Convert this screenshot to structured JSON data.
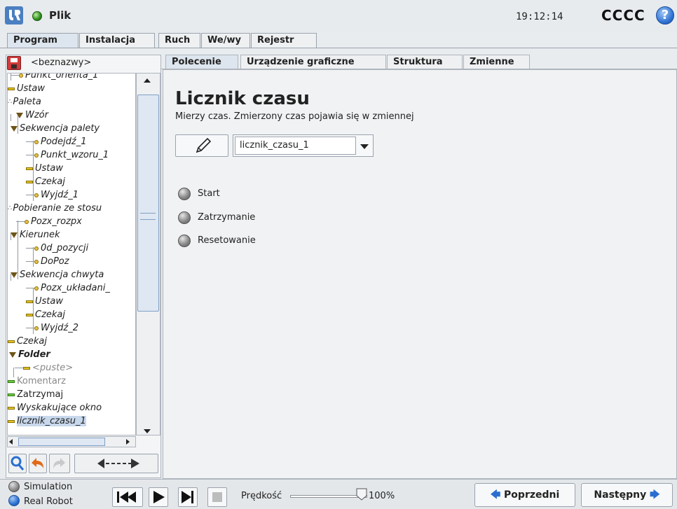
{
  "titlebar": {
    "file_menu": "Plik",
    "clock": "19:12:14",
    "robot_name": "CCCC",
    "help_label": "?"
  },
  "main_tabs": [
    "Program",
    "Instalacja",
    "Ruch",
    "We/wy",
    "Rejestr"
  ],
  "program": {
    "name": "<beznazwy>"
  },
  "tree": [
    {
      "label": "Punkt_orienta_1",
      "icon": "waypoint-icon"
    },
    {
      "label": "Ustaw",
      "icon": "set-icon"
    },
    {
      "label": "Paleta",
      "icon": "pallet-icon"
    },
    {
      "label": "Wzór",
      "icon": "folder-triangle-icon"
    },
    {
      "label": "Sekwencja palety",
      "icon": "folder-triangle-icon"
    },
    {
      "label": "Podejdź_1",
      "icon": "waypoint-icon"
    },
    {
      "label": "Punkt_wzoru_1",
      "icon": "waypoint-icon"
    },
    {
      "label": "Ustaw",
      "icon": "set-icon"
    },
    {
      "label": "Czekaj",
      "icon": "wait-icon"
    },
    {
      "label": "Wyjdź_1",
      "icon": "waypoint-icon"
    },
    {
      "label": "Pobieranie ze stosu",
      "icon": "stack-icon"
    },
    {
      "label": "Pozx_rozpx",
      "icon": "waypoint-icon"
    },
    {
      "label": "Kierunek",
      "icon": "folder-triangle-icon"
    },
    {
      "label": "0d_pozycji",
      "icon": "waypoint-icon"
    },
    {
      "label": "DoPoz",
      "icon": "waypoint-icon"
    },
    {
      "label": "Sekwencja chwyta",
      "icon": "folder-triangle-icon"
    },
    {
      "label": "Pozx_układani_",
      "icon": "waypoint-icon"
    },
    {
      "label": "Ustaw",
      "icon": "set-icon"
    },
    {
      "label": "Czekaj",
      "icon": "wait-icon"
    },
    {
      "label": "Wyjdź_2",
      "icon": "waypoint-icon"
    },
    {
      "label": "Czekaj",
      "icon": "wait-icon"
    },
    {
      "label": "Folder",
      "icon": "folder-triangle-icon"
    },
    {
      "label": "<puste>",
      "icon": "empty-icon"
    },
    {
      "label": "Komentarz",
      "icon": "comment-icon"
    },
    {
      "label": "Zatrzymaj",
      "icon": "halt-icon"
    },
    {
      "label": "Wyskakujące okno",
      "icon": "popup-icon"
    },
    {
      "label": "licznik_czasu_1",
      "icon": "timer-icon"
    }
  ],
  "sub_tabs": [
    "Polecenie",
    "Urządzenie graficzne",
    "Struktura",
    "Zmienne"
  ],
  "command": {
    "title": "Licznik czasu",
    "description": "Mierzy czas. Zmierzony czas pojawia się w zmiennej",
    "variable": "licznik_czasu_1",
    "options": [
      "Start",
      "Zatrzymanie",
      "Resetowanie"
    ]
  },
  "bottom": {
    "simulation": "Simulation",
    "real_robot": "Real Robot",
    "speed_label": "Prędkość",
    "speed_value": "100%",
    "speed_fraction": 1.0,
    "prev": "Poprzedni",
    "next": "Następny"
  },
  "colors": {
    "active_tab": "#dde5ee",
    "waypoint": "#e8c240",
    "set": "#e3c324",
    "comment": "#6ccc38",
    "selected_row": "#c8d8ec"
  }
}
